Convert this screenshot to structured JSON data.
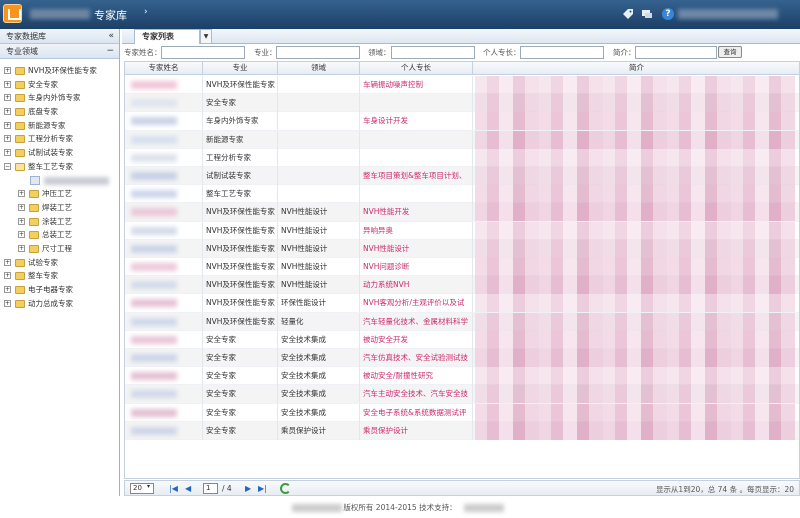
{
  "topbar": {
    "title": "专家库",
    "arrow": "›",
    "help": "?"
  },
  "left": {
    "header": "专家数据库",
    "collapse": "«",
    "subheader": "专业领域",
    "subcollapse": "−",
    "tree": [
      {
        "label": "NVH及环保性能专家",
        "level": 0,
        "exp": "+"
      },
      {
        "label": "安全专家",
        "level": 0,
        "exp": "+"
      },
      {
        "label": "车身内外饰专家",
        "level": 0,
        "exp": "+"
      },
      {
        "label": "底盘专家",
        "level": 0,
        "exp": "+"
      },
      {
        "label": "新能源专家",
        "level": 0,
        "exp": "+"
      },
      {
        "label": "工程分析专家",
        "level": 0,
        "exp": "+"
      },
      {
        "label": "试制试装专家",
        "level": 0,
        "exp": "+"
      },
      {
        "label": "整车工艺专家",
        "level": 0,
        "exp": "−",
        "open": true
      },
      {
        "label": "",
        "level": 1,
        "selected": true
      },
      {
        "label": "冲压工艺",
        "level": 1,
        "exp": "+"
      },
      {
        "label": "焊装工艺",
        "level": 1,
        "exp": "+"
      },
      {
        "label": "涂装工艺",
        "level": 1,
        "exp": "+"
      },
      {
        "label": "总装工艺",
        "level": 1,
        "exp": "+"
      },
      {
        "label": "尺寸工程",
        "level": 1,
        "exp": "+"
      },
      {
        "label": "试验专家",
        "level": 0,
        "exp": "+"
      },
      {
        "label": "整车专家",
        "level": 0,
        "exp": "+"
      },
      {
        "label": "电子电器专家",
        "level": 0,
        "exp": "+"
      },
      {
        "label": "动力总成专家",
        "level": 0,
        "exp": "+"
      }
    ]
  },
  "main": {
    "tab": "专家列表",
    "tab_drop": "▼",
    "filters": {
      "name_label": "专家姓名：",
      "major_label": "专业：",
      "field_label": "领域：",
      "specialty_label": "个人专长：",
      "intro_label": "简介：",
      "search": "查询"
    },
    "columns": [
      "专家姓名",
      "专业",
      "领域",
      "个人专长",
      "简介"
    ],
    "rows": [
      {
        "major": "NVH及环保性能专家",
        "field": "",
        "specialty": "车辆振动噪声控制",
        "blur": "#f1c6d8"
      },
      {
        "major": "安全专家",
        "field": "",
        "specialty": "",
        "blur": "#dfe4ee"
      },
      {
        "major": "车身内外饰专家",
        "field": "",
        "specialty": "车身设计开发",
        "blur": "#c9d3e6"
      },
      {
        "major": "新能源专家",
        "field": "",
        "specialty": "",
        "blur": "#d6dff0"
      },
      {
        "major": "工程分析专家",
        "field": "",
        "specialty": "",
        "blur": "#dde2ea"
      },
      {
        "major": "试制试装专家",
        "field": "",
        "specialty": "整车项目策划&整车项目计划、",
        "blur": "#c6d0e6"
      },
      {
        "major": "整车工艺专家",
        "field": "",
        "specialty": "",
        "blur": "#cdd7ea"
      },
      {
        "major": "NVH及环保性能专家",
        "field": "NVH性能设计",
        "specialty": "NVH性能开发",
        "blur": "#eac7d8"
      },
      {
        "major": "NVH及环保性能专家",
        "field": "NVH性能设计",
        "specialty": "异响异奥",
        "blur": "#d4dbe9"
      },
      {
        "major": "NVH及环保性能专家",
        "field": "NVH性能设计",
        "specialty": "NVH性能设计",
        "blur": "#cad4e8"
      },
      {
        "major": "NVH及环保性能专家",
        "field": "NVH性能设计",
        "specialty": "NVH问题诊断",
        "blur": "#ecc9da"
      },
      {
        "major": "NVH及环保性能专家",
        "field": "NVH性能设计",
        "specialty": "动力系统NVH",
        "blur": "#d3dbea"
      },
      {
        "major": "NVH及环保性能专家",
        "field": "环保性能设计",
        "specialty": "NVH客观分析/主观评价以及试",
        "blur": "#e6c2d5"
      },
      {
        "major": "NVH及环保性能专家",
        "field": "轻量化",
        "specialty": "汽车轻量化技术、金属材料科学",
        "blur": "#d0d8ea"
      },
      {
        "major": "安全专家",
        "field": "安全技术集成",
        "specialty": "被动安全开发",
        "blur": "#e9c6d8"
      },
      {
        "major": "安全专家",
        "field": "安全技术集成",
        "specialty": "汽车仿真技术、安全试验测试技",
        "blur": "#ccd5e8"
      },
      {
        "major": "安全专家",
        "field": "安全技术集成",
        "specialty": "被动安全/耐撞性研究",
        "blur": "#e4c1d3"
      },
      {
        "major": "安全专家",
        "field": "安全技术集成",
        "specialty": "汽车主动安全技术、汽车安全技",
        "blur": "#d1d9ea"
      },
      {
        "major": "安全专家",
        "field": "安全技术集成",
        "specialty": "安全电子系统&系统数据测试评",
        "blur": "#e2c0d2"
      },
      {
        "major": "安全专家",
        "field": "乘员保护设计",
        "specialty": "乘员保护设计",
        "blur": "#ced6e8"
      }
    ]
  },
  "pager": {
    "page_size": "20",
    "page": "1",
    "total": "/ 4",
    "summary": "显示从1到20，总 74 条 。每页显示：20"
  },
  "footer": {
    "text": "版权所有 2014-2015 技术支持："
  }
}
